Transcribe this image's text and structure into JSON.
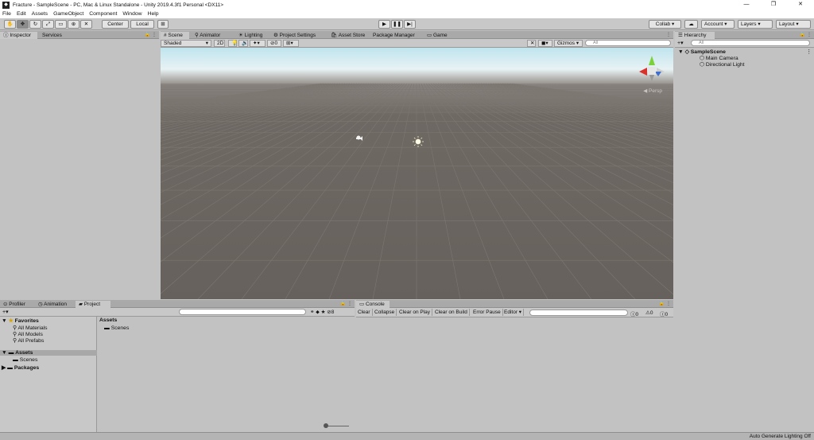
{
  "window": {
    "title": "Fracture - SampleScene - PC, Mac & Linux Standalone - Unity 2019.4.3f1 Personal <DX11>",
    "controls": [
      "—",
      "❐",
      "✕"
    ]
  },
  "menu": [
    "File",
    "Edit",
    "Assets",
    "GameObject",
    "Component",
    "Window",
    "Help"
  ],
  "toolbar": {
    "pivot": "Center",
    "space": "Local",
    "collab": "Collab ▾",
    "account": "Account",
    "layers": "Layers",
    "layout": "Layout"
  },
  "left_tabs": [
    "Inspector",
    "Services"
  ],
  "scene_tabs": [
    "Scene",
    "Animator",
    "Lighting",
    "Project Settings",
    "Asset Store",
    "Package Manager",
    "Game"
  ],
  "scene_bar": {
    "shading": "Shaded",
    "mode2d": "2D",
    "fx_count": "0",
    "gizmos": "Gizmos",
    "search_placeholder": "All"
  },
  "scene_view": {
    "persp_label": "Persp",
    "sky_color": "#d8eef5",
    "ground_color": "#6b6560"
  },
  "hierarchy": {
    "tab": "Hierarchy",
    "search_placeholder": "All",
    "scene": "SampleScene",
    "items": [
      "Main Camera",
      "Directional Light"
    ]
  },
  "bottom_tabs": [
    "Profiler",
    "Animation",
    "Project"
  ],
  "project": {
    "favorites_label": "Favorites",
    "favorites": [
      "All Materials",
      "All Models",
      "All Prefabs"
    ],
    "assets_label": "Assets",
    "assets_children": [
      "Scenes"
    ],
    "packages_label": "Packages",
    "breadcrumb": "Assets",
    "content": [
      "Scenes"
    ],
    "hidden_count": "8"
  },
  "console": {
    "tab": "Console",
    "buttons": [
      "Clear",
      "Collapse",
      "Clear on Play",
      "Clear on Build",
      "Error Pause",
      "Editor ▾"
    ],
    "counts": [
      "0",
      "0",
      "0"
    ]
  },
  "status": "Auto Generate Lighting Off"
}
